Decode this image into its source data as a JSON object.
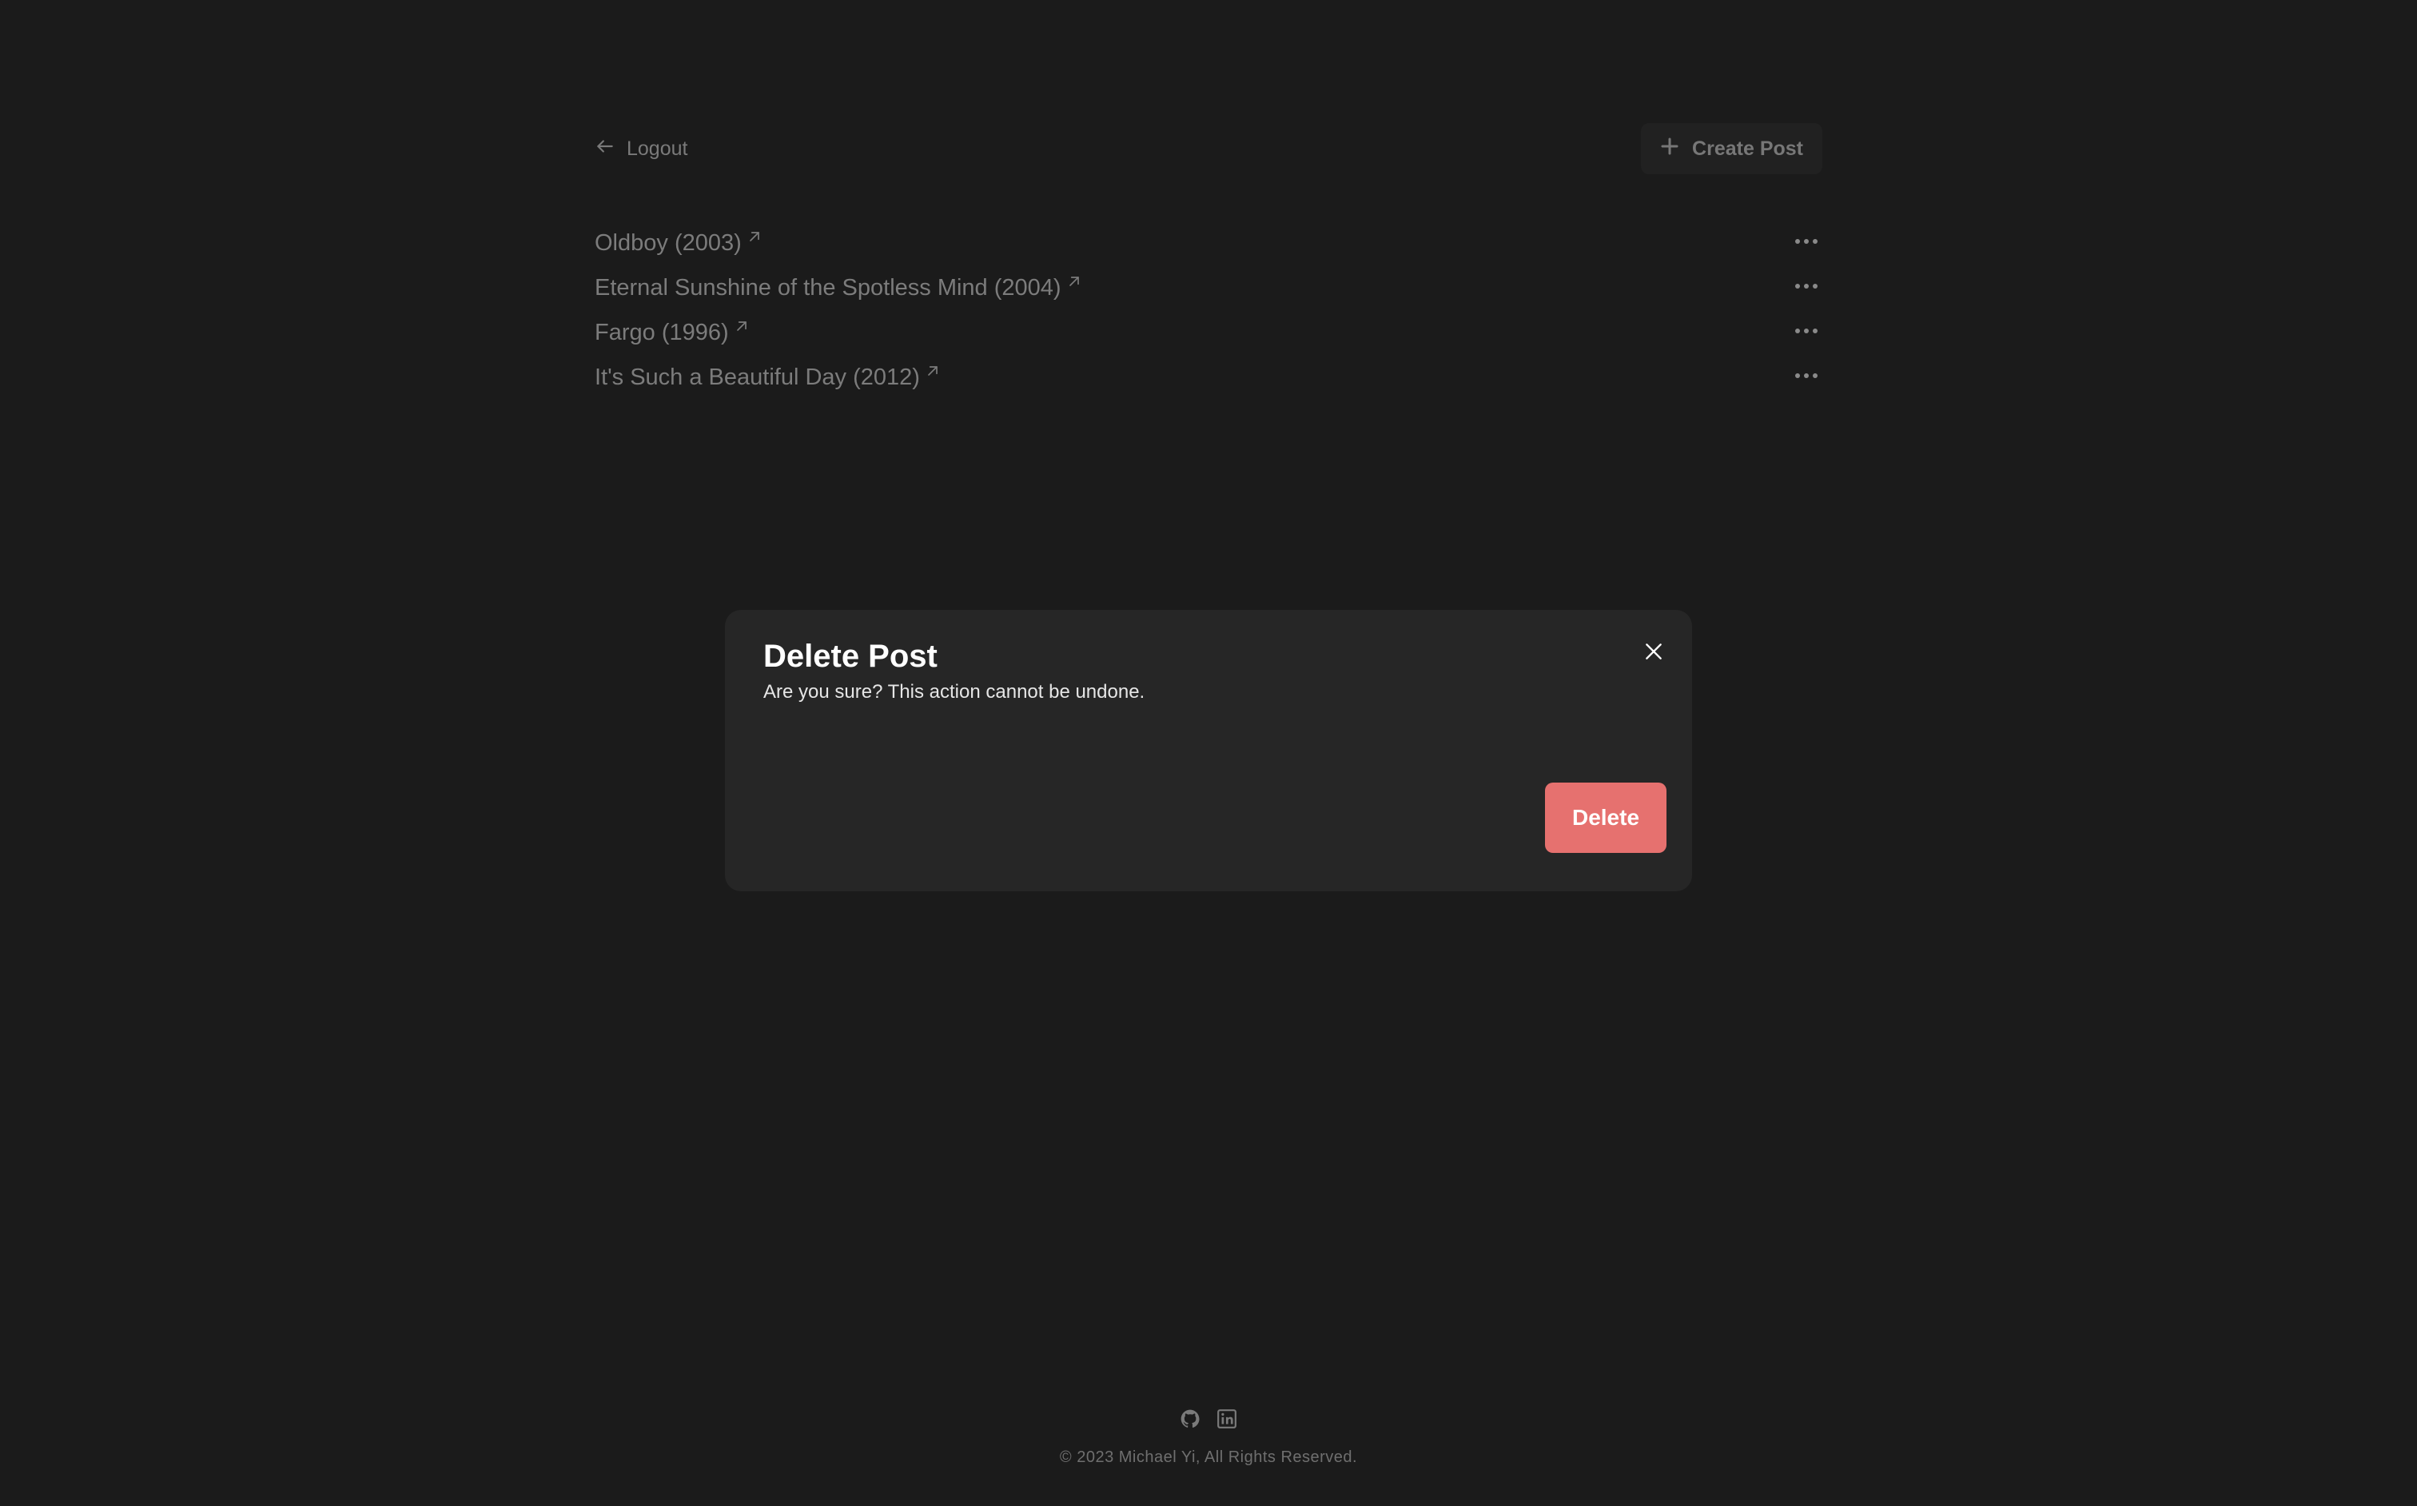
{
  "header": {
    "logout_label": "Logout",
    "create_label": "Create Post"
  },
  "posts": [
    {
      "title": "Oldboy (2003)"
    },
    {
      "title": "Eternal Sunshine of the Spotless Mind (2004)"
    },
    {
      "title": "Fargo (1996)"
    },
    {
      "title": "It's Such a Beautiful Day (2012)"
    }
  ],
  "modal": {
    "title": "Delete Post",
    "description": "Are you sure? This action cannot be undone.",
    "delete_label": "Delete"
  },
  "footer": {
    "icons": [
      "github-icon",
      "linkedin-icon"
    ],
    "copyright": "© 2023 Michael Yi, All Rights Reserved."
  },
  "colors": {
    "background": "#1b1b1b",
    "modal_background": "#262626",
    "delete_button": "#e6716f",
    "muted_text": "#7c7c7c"
  }
}
